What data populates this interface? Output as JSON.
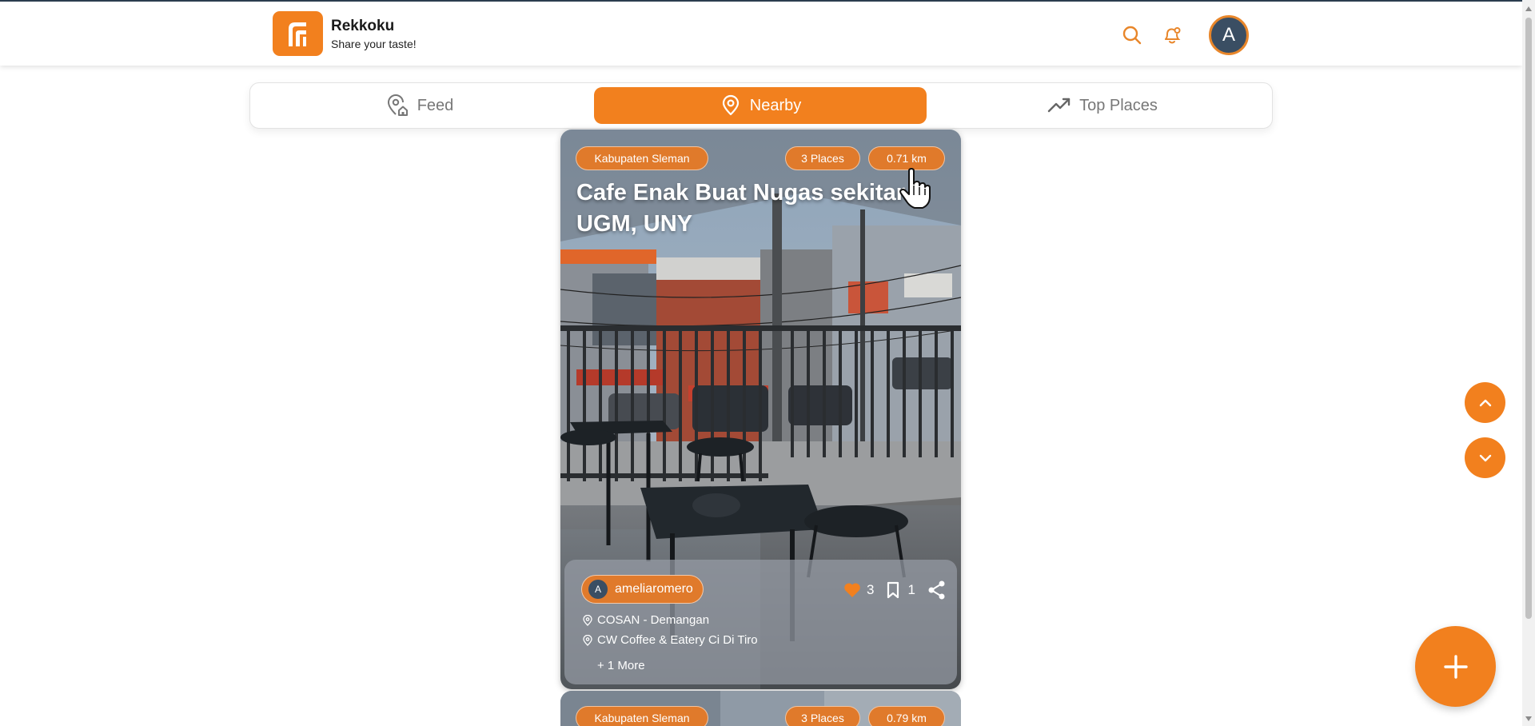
{
  "app": {
    "title": "Rekkoku",
    "subtitle": "Share your taste!",
    "user_initial": "A",
    "accent": "#f2801e"
  },
  "header_icons": [
    "search-icon",
    "bell-icon"
  ],
  "tabs": [
    {
      "label": "Feed",
      "icon": "location-home-icon",
      "active": false
    },
    {
      "label": "Nearby",
      "icon": "map-pin-icon",
      "active": true
    },
    {
      "label": "Top Places",
      "icon": "trending-up-icon",
      "active": false
    }
  ],
  "cards": [
    {
      "region": "Kabupaten Sleman",
      "places_count": "3 Places",
      "distance": "0.71 km",
      "title": "Cafe Enak Buat Nugas sekitar UGM, UNY",
      "author_initial": "A",
      "author": "ameliaromero",
      "likes": "3",
      "bookmarks": "1",
      "places": [
        "COSAN - Demangan",
        "CW Coffee & Eatery Ci Di Tiro"
      ],
      "more": "+ 1 More"
    },
    {
      "region": "Kabupaten Sleman",
      "places_count": "3 Places",
      "distance": "0.79 km"
    }
  ],
  "controls": {
    "scroll_up": "chevron-up-icon",
    "scroll_down": "chevron-down-icon",
    "add": "plus-icon"
  }
}
